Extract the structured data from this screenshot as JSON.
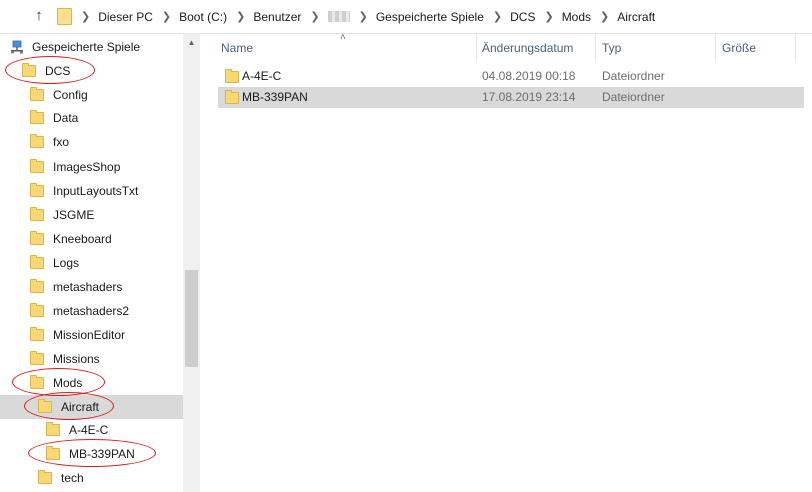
{
  "address_bar": {
    "breadcrumbs": [
      "Dieser PC",
      "Boot (C:)",
      "Benutzer",
      "",
      "Gespeicherte Spiele",
      "DCS",
      "Mods",
      "Aircraft"
    ]
  },
  "nav": {
    "root": "Gespeicherte Spiele",
    "items": [
      {
        "label": "DCS"
      },
      {
        "label": "Config"
      },
      {
        "label": "Data"
      },
      {
        "label": "fxo"
      },
      {
        "label": "ImagesShop"
      },
      {
        "label": "InputLayoutsTxt"
      },
      {
        "label": "JSGME"
      },
      {
        "label": "Kneeboard"
      },
      {
        "label": "Logs"
      },
      {
        "label": "metashaders"
      },
      {
        "label": "metashaders2"
      },
      {
        "label": "MissionEditor"
      },
      {
        "label": "Missions"
      },
      {
        "label": "Mods"
      },
      {
        "label": "Aircraft"
      },
      {
        "label": "A-4E-C"
      },
      {
        "label": "MB-339PAN"
      },
      {
        "label": "tech"
      }
    ],
    "selected": "Aircraft"
  },
  "columns": {
    "name": "Name",
    "date": "Änderungsdatum",
    "type": "Typ",
    "size": "Größe"
  },
  "files": [
    {
      "name": "A-4E-C",
      "date": "04.08.2019 00:18",
      "type": "Dateiordner",
      "size": ""
    },
    {
      "name": "MB-339PAN",
      "date": "17.08.2019 23:14",
      "type": "Dateiordner",
      "size": ""
    }
  ],
  "colors": {
    "annotation": "#d41e1e",
    "selection": "#d9d9d9",
    "header_text": "#4c607a",
    "folder": "#f8d775"
  },
  "icons": {
    "up": "up-arrow-icon",
    "folder": "folder-icon",
    "network": "network-folder-icon"
  }
}
